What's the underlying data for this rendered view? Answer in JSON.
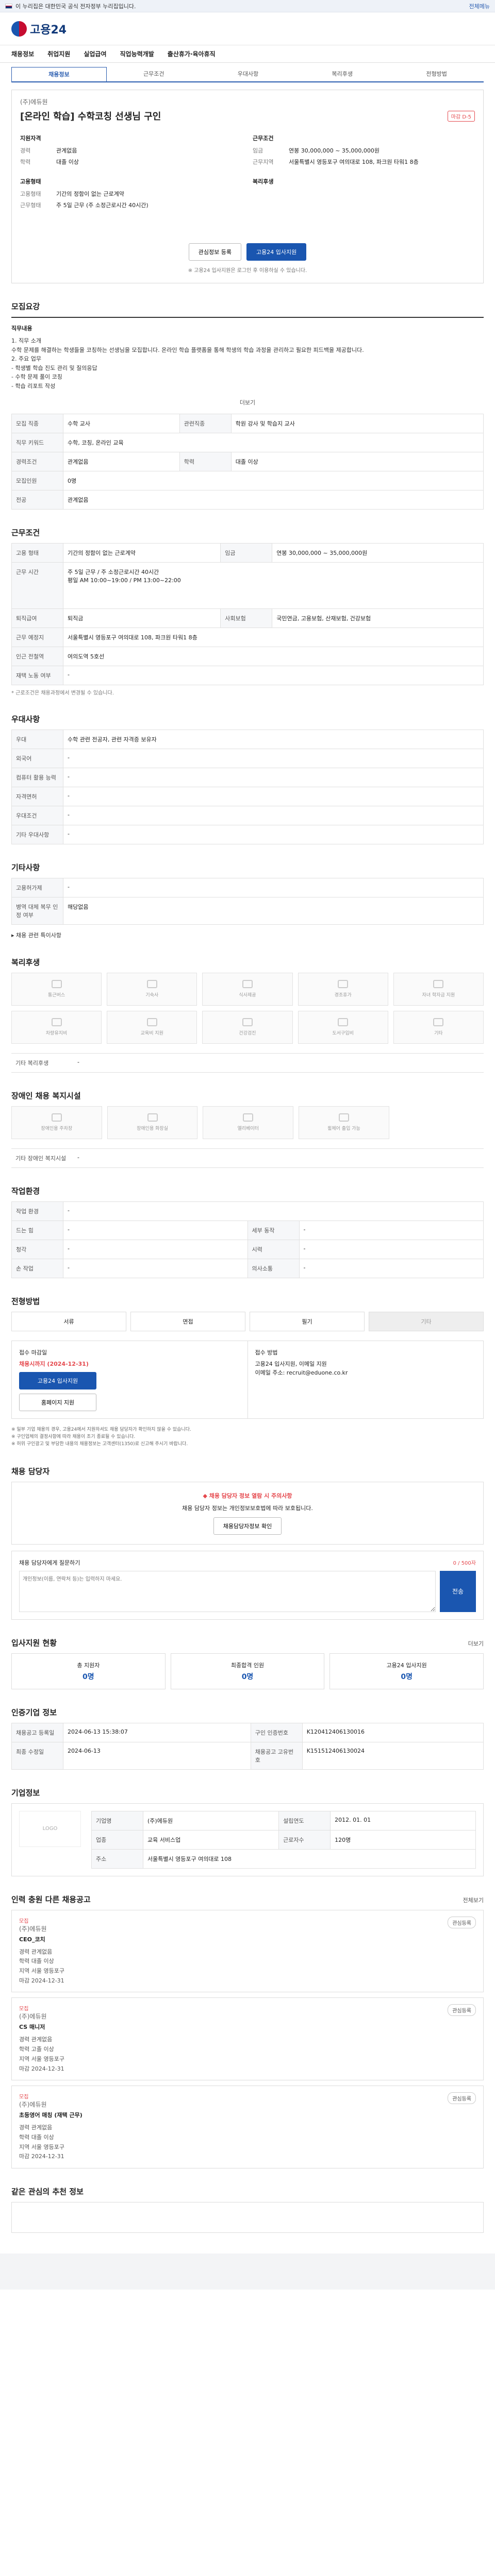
{
  "gov_banner": {
    "text": "이 누리집은 대한민국 공식 전자정부 누리집입니다.",
    "right": "전체메뉴"
  },
  "header": {
    "logo": "고용24"
  },
  "gnb": [
    "채용정보",
    "취업지원",
    "실업급여",
    "직업능력개발",
    "출산휴가·육아휴직"
  ],
  "tabs": [
    "채용정보",
    "근무조건",
    "우대사항",
    "복리후생",
    "전형방법"
  ],
  "job": {
    "company": "(주)에듀원",
    "title": "[온라인 학습] 수학코칭 선생님 구인",
    "badge": "마감 D-5",
    "left_head": "지원자격",
    "left_rows": [
      {
        "k": "경력",
        "v": "관계없음"
      },
      {
        "k": "학력",
        "v": "대졸 이상"
      }
    ],
    "left_head2": "고용형태",
    "left_rows2": [
      {
        "k": "고용형태",
        "v": "기간의 정함이 없는 근로계약"
      },
      {
        "k": "근무형태",
        "v": "주 5일 근무 (주 소정근로시간 40시간)"
      }
    ],
    "right_head": "근무조건",
    "right_rows": [
      {
        "k": "임금",
        "v": "연봉 30,000,000 ~ 35,000,000원"
      },
      {
        "k": "근무지역",
        "v": "서울특별시 영등포구 여의대로 108, 파크원 타워1 8층"
      }
    ],
    "right_head2": "복리후생",
    "save_btn": "관심정보 등록",
    "apply_btn": "고용24 입사지원",
    "note": "※ 고용24 입사지원은 로그인 후 이용하실 수 있습니다."
  },
  "recruit": {
    "title": "모집요강",
    "job_content_label": "직무내용",
    "desc": "1. 직무 소개\n수학 문제를 해결하는 학생들을 코칭하는 선생님을 모집합니다. 온라인 학습 플랫폼을 통해 학생의 학습 과정을 관리하고 필요한 피드백을 제공합니다.\n2. 주요 업무\n- 학생별 학습 진도 관리 및 질의응답\n- 수학 문제 풀이 코칭\n- 학습 리포트 작성",
    "more": "더보기",
    "rows": [
      {
        "k": "모집 직종",
        "v": "수학 교사",
        "k2": "관련직종",
        "v2": "학원 강사 및 학습지 교사"
      },
      {
        "k": "직무 키워드",
        "v": "수학, 코칭, 온라인 교육",
        "k2": "",
        "v2": ""
      },
      {
        "k": "경력조건",
        "v": "관계없음",
        "k2": "학력",
        "v2": "대졸 이상"
      },
      {
        "k": "모집인원",
        "v": "0명",
        "k2": "",
        "v2": ""
      },
      {
        "k": "전공",
        "v": "관계없음",
        "k2": "",
        "v2": ""
      }
    ]
  },
  "work": {
    "title": "근무조건",
    "rows": [
      {
        "k": "고용 형태",
        "v": "기간의 정함이 없는 근로계약",
        "k2": "임금",
        "v2": "연봉 30,000,000 ~ 35,000,000원"
      },
      {
        "k": "근무 시간",
        "v": "주 5일 근무 / 주 소정근로시간 40시간\n평일 AM 10:00~19:00 / PM 13:00~22:00",
        "k2": "",
        "v2": ""
      },
      {
        "k": "퇴직급여",
        "v": "퇴직금",
        "k2": "사회보험",
        "v2": "국민연금, 고용보험, 산재보험, 건강보험"
      },
      {
        "k": "근무 예정지",
        "v": "서울특별시 영등포구 여의대로 108, 파크원 타워1 8층",
        "k2": "",
        "v2": ""
      },
      {
        "k": "인근 전철역",
        "v": "여의도역 5호선",
        "k2": "",
        "v2": ""
      },
      {
        "k": "재택 노동 여부",
        "v": "-",
        "k2": "",
        "v2": ""
      }
    ],
    "note": "* 근로조건은 채용과정에서 변경될 수 있습니다."
  },
  "pref": {
    "title": "우대사항",
    "rows": [
      {
        "k": "우대",
        "v": "수학 관련 전공자, 관련 자격증 보유자"
      },
      {
        "k": "외국어",
        "v": "-"
      },
      {
        "k": "컴퓨터 활용 능력",
        "v": "-"
      },
      {
        "k": "자격면허",
        "v": "-"
      },
      {
        "k": "우대조건",
        "v": "-"
      },
      {
        "k": "기타 우대사항",
        "v": "-"
      }
    ]
  },
  "other": {
    "title": "기타사항",
    "rows": [
      {
        "k": "고용허가제",
        "v": "-"
      },
      {
        "k": "병역 대체 복무 인정 여부",
        "v": "해당없음"
      }
    ],
    "link": "채용 관련 특이사항"
  },
  "welfare": {
    "title": "복리후생",
    "cards": [
      "통근버스",
      "기숙사",
      "식사제공",
      "경조휴가",
      "자녀 학자금 지원",
      "차량유지비",
      "교육비 지원",
      "건강검진",
      "도서구입비",
      "기타"
    ],
    "row_k": "기타 복리후생",
    "row_v": "-"
  },
  "disability": {
    "title": "장애인 채용 복지시설",
    "cards": [
      "장애인용 주차장",
      "장애인용 화장실",
      "엘리베이터",
      "휠체어 출입 가능"
    ],
    "row_k": "기타 장애인 복지시설",
    "row_v": "-"
  },
  "work_env": {
    "title": "작업환경",
    "rows": [
      {
        "k": "작업 환경",
        "v": "-",
        "k2": "",
        "v2": ""
      },
      {
        "k": "드는 힘",
        "v": "-",
        "k2": "세부 동작",
        "v2": "-"
      },
      {
        "k": "청각",
        "v": "-",
        "k2": "시력",
        "v2": "-"
      },
      {
        "k": "손 작업",
        "v": "-",
        "k2": "의사소통",
        "v2": "-"
      }
    ]
  },
  "hiring": {
    "title": "전형방법",
    "methods": [
      "서류",
      "면접",
      "필기",
      "기타"
    ],
    "deadline_label": "접수 마감일",
    "deadline": "채용시까지 (2024-12-31)",
    "apply_btn": "고용24 입사지원",
    "home_btn": "홈페이지 지원",
    "method_label": "접수 방법",
    "method_text": "고용24 입사지원, 이메일 지원\n이메일 주소: recruit@eduone.co.kr",
    "warnings": [
      "※ 일부 기업 채용의 경우, 고용24에서 지원하셔도 채용 담당자가 확인하지 않을 수 있습니다.",
      "※ 구인업체의 결정사항에 따라 채용이 조기 종료될 수 있습니다.",
      "※ 허위 구인광고 및 부당한 내용의 채용정보는 고객센터(1350)로 신고해 주시기 바랍니다."
    ]
  },
  "report": {
    "title": "채용 담당자",
    "warn": "◆ 채용 담당자 정보 열람 시 주의사항",
    "text": "채용 담당자 정보는 개인정보보호법에 따라 보호됩니다.",
    "btn": "채용담당자정보 확인"
  },
  "inquiry": {
    "label": "채용 담당자에게 질문하기",
    "count": "0 / 500자",
    "placeholder": "개인정보(이름, 연락처 등)는 입력하지 마세요.",
    "send": "전송"
  },
  "applicants": {
    "title": "입사지원 현황",
    "right": "더보기",
    "stats": [
      {
        "label": "총 지원자",
        "num": "0명"
      },
      {
        "label": "최종합격 인원",
        "num": "0명"
      },
      {
        "label": "고용24 입사지원",
        "num": "0명"
      }
    ]
  },
  "manage": {
    "title": "인증기업 정보",
    "rows": [
      {
        "k": "채용공고 등록일",
        "v": "2024-06-13 15:38:07",
        "k2": "구인 인증번호",
        "v2": "K120412406130016"
      },
      {
        "k": "최종 수정일",
        "v": "2024-06-13",
        "k2": "채용공고 고유번호",
        "v2": "K151512406130024"
      }
    ]
  },
  "company_info": {
    "title": "기업정보",
    "logo": "LOGO",
    "rows": [
      {
        "k": "기업명",
        "v": "(주)에듀원",
        "k2": "설립연도",
        "v2": "2012. 01. 01"
      },
      {
        "k": "업종",
        "v": "교육 서비스업",
        "k2": "근로자수",
        "v2": "120명"
      },
      {
        "k": "주소",
        "v": "서울특별시 영등포구 여의대로 108",
        "k2": "",
        "v2": ""
      }
    ]
  },
  "recommend": {
    "title": "인력 충원 다른 채용공고",
    "right": "전체보기",
    "items": [
      {
        "tag": "모집",
        "company": "(주)에듀원",
        "title": "CEO_코치",
        "lines": [
          "경력 관계없음",
          "학력 대졸 이상",
          "지역 서울 영등포구",
          "마감 2024-12-31"
        ],
        "save": "관심등록"
      },
      {
        "tag": "모집",
        "company": "(주)에듀원",
        "title": "CS 매니저",
        "lines": [
          "경력 관계없음",
          "학력 고졸 이상",
          "지역 서울 영등포구",
          "마감 2024-12-31"
        ],
        "save": "관심등록"
      },
      {
        "tag": "모집",
        "company": "(주)에듀원",
        "title": "초등영어 매칭 (재택 근무)",
        "lines": [
          "경력 관계없음",
          "학력 대졸 이상",
          "지역 서울 영등포구",
          "마감 2024-12-31"
        ],
        "save": "관심등록"
      }
    ]
  },
  "last": {
    "title": "같은 관심의 추천 정보"
  }
}
